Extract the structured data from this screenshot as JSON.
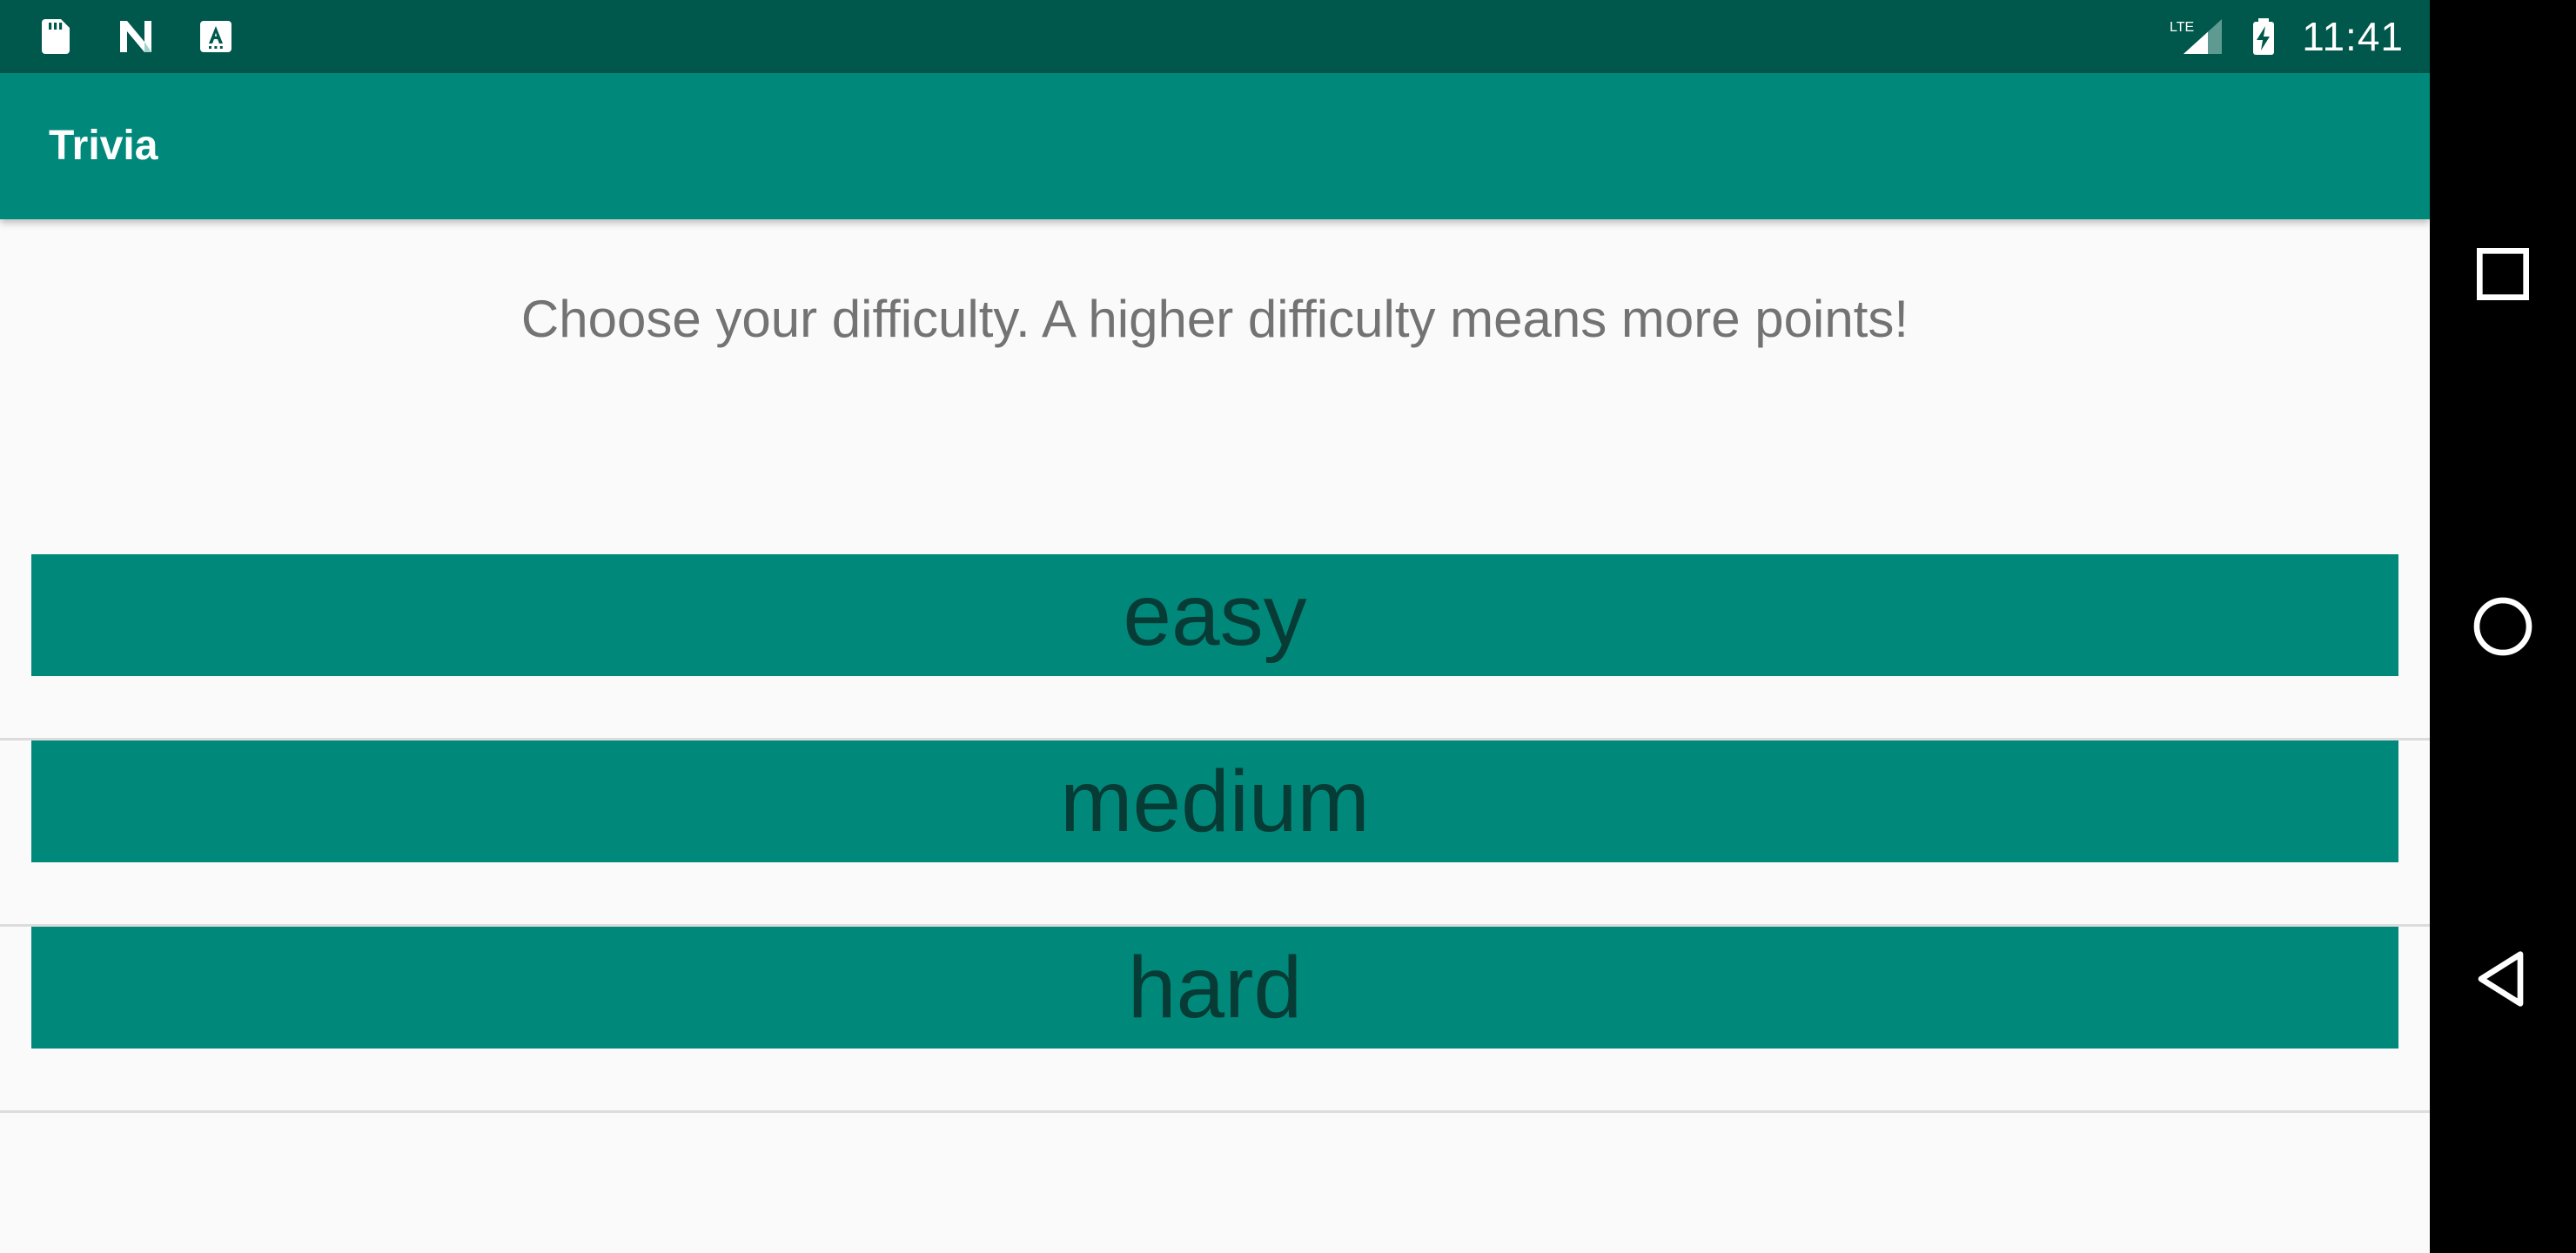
{
  "status_bar": {
    "left_icons": [
      "sd-card-icon",
      "n-logo-icon",
      "a-notification-icon"
    ],
    "network_label": "LTE",
    "time": "11:41"
  },
  "app_bar": {
    "title": "Trivia"
  },
  "prompt": "Choose your difficulty. A higher difficulty means more points!",
  "difficulties": [
    {
      "label": "easy"
    },
    {
      "label": "medium"
    },
    {
      "label": "hard"
    }
  ],
  "nav_bar": {
    "buttons": [
      "recents-icon",
      "home-icon",
      "back-icon"
    ]
  },
  "colors": {
    "status_bar": "#00574b",
    "app_bar": "#00897b",
    "button": "#00897b",
    "button_text": "#073b35",
    "background": "#fafafa",
    "prompt_text": "#737373"
  }
}
